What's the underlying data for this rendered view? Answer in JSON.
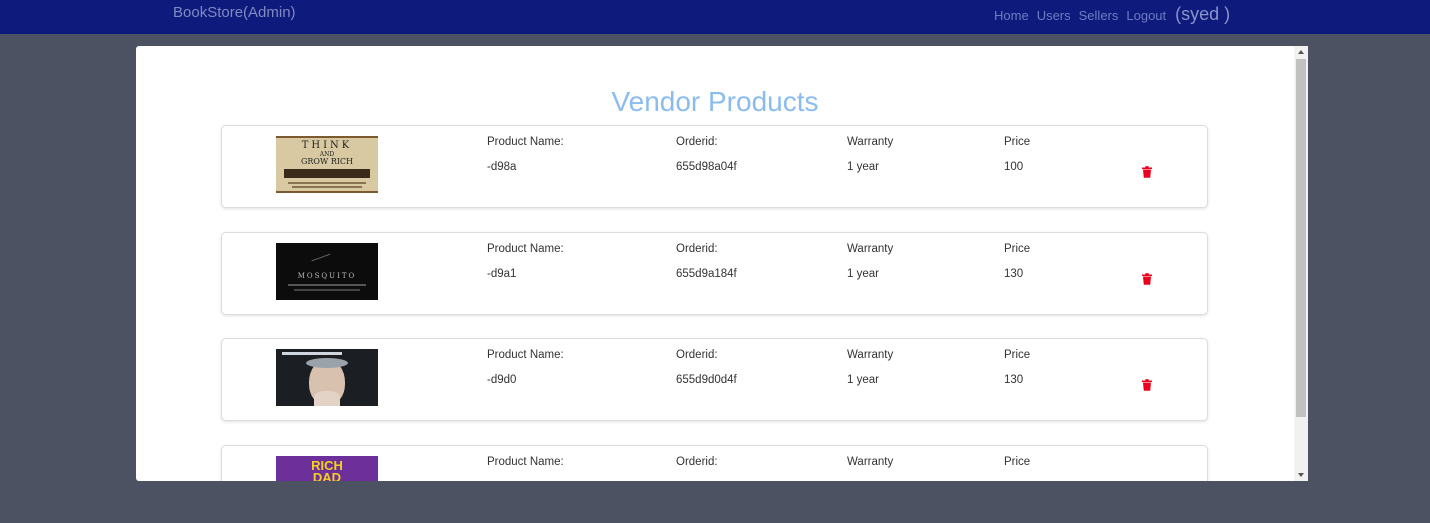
{
  "navbar": {
    "brand": "BookStore(Admin)",
    "links": [
      "Home",
      "Users",
      "Sellers",
      "Logout"
    ],
    "user": "(syed )"
  },
  "page": {
    "title": "Vendor Products"
  },
  "labels": {
    "product_name": "Product Name:",
    "orderid": "Orderid:",
    "warranty": "Warranty",
    "price": "Price"
  },
  "products": [
    {
      "cover": "think-and-grow-rich",
      "cover_text": [
        "THINK",
        "AND",
        "GROW RICH"
      ],
      "name": "-d98a",
      "orderid": "655d98a04f",
      "warranty": "1 year",
      "price": "100"
    },
    {
      "cover": "mosquito",
      "cover_text": [
        "MOSQUITO"
      ],
      "name": "-d9a1",
      "orderid": "655d9a184f",
      "warranty": "1 year",
      "price": "130"
    },
    {
      "cover": "portrait",
      "name": "-d9d0",
      "orderid": "655d9d0d4f",
      "warranty": "1 year",
      "price": "130"
    },
    {
      "cover": "rich-dad",
      "cover_text": [
        "RICH",
        "DAD"
      ],
      "name": "",
      "orderid": "",
      "warranty": "",
      "price": ""
    }
  ],
  "icons": {
    "delete": "trash-icon"
  },
  "colors": {
    "navbar": "#0f1a7d",
    "title": "#8bbcf0",
    "delete": "#e8001c",
    "background": "#4d5262"
  }
}
